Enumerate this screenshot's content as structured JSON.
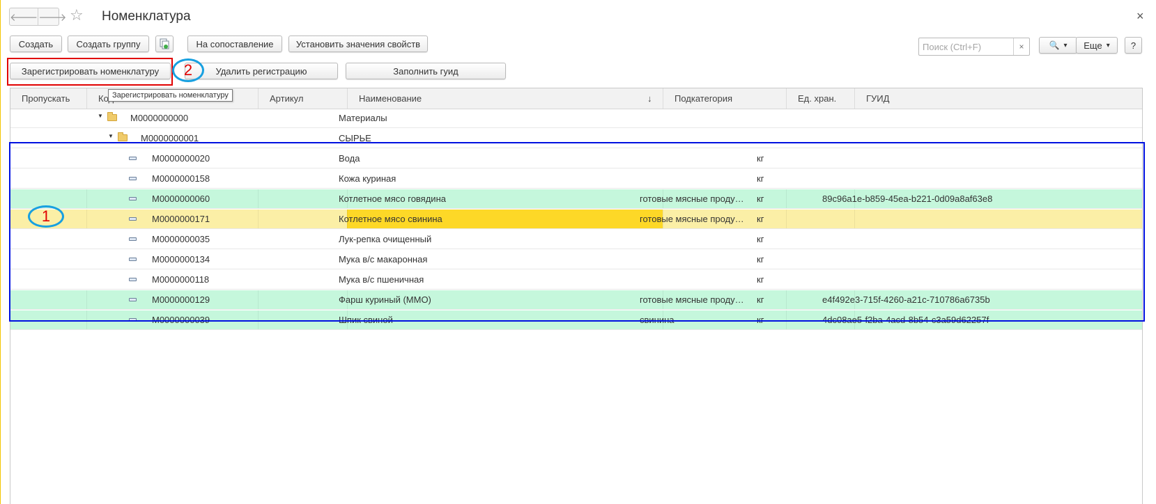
{
  "window": {
    "title": "Номенклатура",
    "back_glyph": "🡐",
    "forward_glyph": "🡒",
    "star_glyph": "☆",
    "close_glyph": "×"
  },
  "toolbar": {
    "create": "Создать",
    "create_group": "Создать группу",
    "copy_icon": "copy-icon",
    "to_matching": "На сопоставление",
    "set_properties": "Установить значения свойств",
    "search_placeholder": "Поиск (Ctrl+F)",
    "search_clear": "×",
    "search_glyph": "🔍",
    "dropdown_glyph": "▾",
    "more": "Еще",
    "help": "?"
  },
  "toolbar2": {
    "register": "Зарегистрировать номенклатуру",
    "delete_registration": "Удалить регистрацию",
    "fill_guid": "Заполнить гуид"
  },
  "tooltip": "Зарегистрировать номенклатуру",
  "annotations": {
    "one": "1",
    "two": "2",
    "blue_color": "#0010e0",
    "red_color": "#e00000",
    "oval_color": "#18a0e0"
  },
  "table": {
    "columns": {
      "skip": "Пропускать",
      "code": "Код",
      "article": "Артикул",
      "name": "Наименование",
      "subcategory": "Подкатегория",
      "unit": "Ед. хран.",
      "guid": "ГУИД"
    },
    "sort_glyph": "↓",
    "rows": [
      {
        "type": "group",
        "level": 0,
        "code": "М0000000000",
        "name": "Материалы",
        "subcategory": "",
        "unit": "",
        "guid": ""
      },
      {
        "type": "group",
        "level": 1,
        "code": "М0000000001",
        "name": "СЫРЬЕ",
        "subcategory": "",
        "unit": "",
        "guid": ""
      },
      {
        "type": "item",
        "level": 2,
        "code": "М0000000020",
        "name": "Вода",
        "subcategory": "",
        "unit": "кг",
        "guid": ""
      },
      {
        "type": "item",
        "level": 2,
        "code": "М0000000158",
        "name": "Кожа куриная",
        "subcategory": "",
        "unit": "кг",
        "guid": ""
      },
      {
        "type": "item",
        "level": 2,
        "code": "М0000000060",
        "name": "Котлетное мясо говядина",
        "subcategory": "готовые мясные продукты",
        "unit": "кг",
        "guid": "89c96a1e-b859-45ea-b221-0d09a8af63e8",
        "state": "registered"
      },
      {
        "type": "item",
        "level": 2,
        "code": "М0000000171",
        "name": "Котлетное мясо свинина",
        "subcategory": "готовые мясные продукты",
        "unit": "кг",
        "guid": "",
        "state": "selected"
      },
      {
        "type": "item",
        "level": 2,
        "code": "М0000000035",
        "name": "Лук-репка очищенный",
        "subcategory": "",
        "unit": "кг",
        "guid": ""
      },
      {
        "type": "item",
        "level": 2,
        "code": "М0000000134",
        "name": "Мука в/с макаронная",
        "subcategory": "",
        "unit": "кг",
        "guid": ""
      },
      {
        "type": "item",
        "level": 2,
        "code": "М0000000118",
        "name": "Мука в/с пшеничная",
        "subcategory": "",
        "unit": "кг",
        "guid": ""
      },
      {
        "type": "item",
        "level": 2,
        "code": "М0000000129",
        "name": "Фарш куриный (ММО)",
        "subcategory": "готовые мясные продукты",
        "unit": "кг",
        "guid": "e4f492e3-715f-4260-a21c-710786a6735b",
        "state": "registered"
      },
      {
        "type": "item",
        "level": 2,
        "code": "М0000000039",
        "name": "Шпик свиной",
        "subcategory": "свинина",
        "unit": "кг",
        "guid": "4dc08ae5-f2ba-4acd-8b54-c3a59d62257f",
        "state": "registered"
      }
    ]
  },
  "colors": {
    "registered_row": "#c5f7dc",
    "selected_row": "#fbefa6",
    "selected_cell": "#fdd827"
  }
}
